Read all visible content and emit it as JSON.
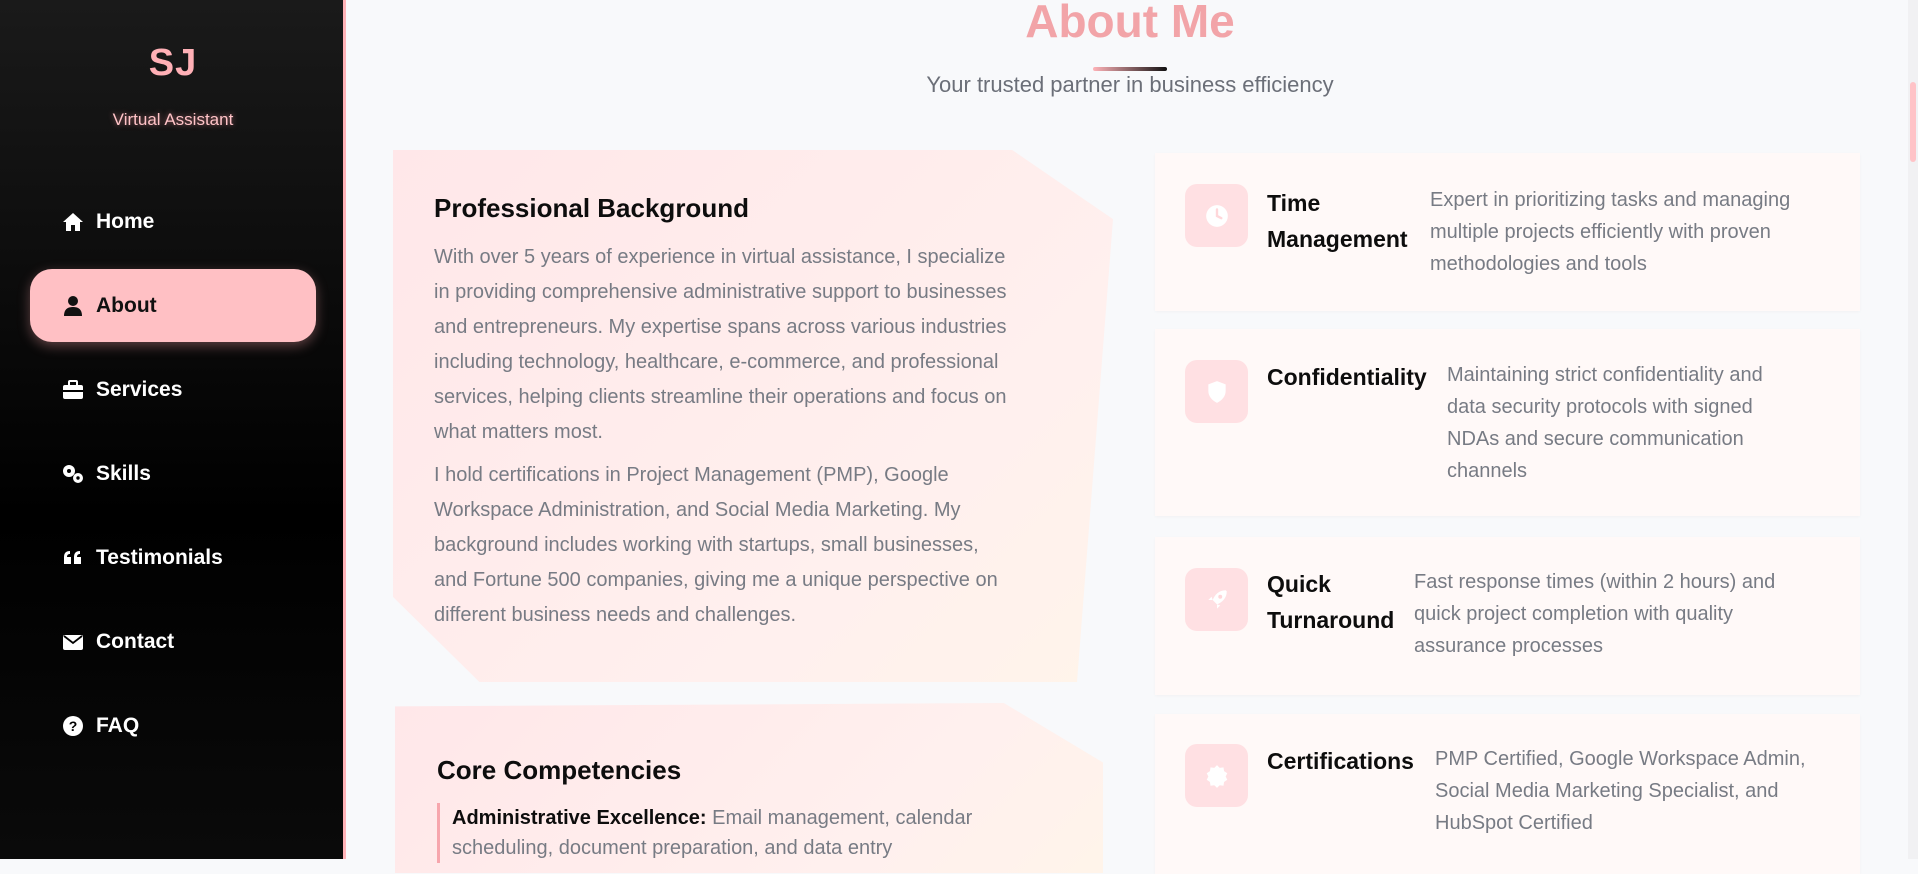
{
  "sidebar": {
    "logo": "SJ",
    "role": "Virtual Assistant",
    "items": [
      {
        "label": "Home",
        "icon": "home-icon",
        "active": false
      },
      {
        "label": "About",
        "icon": "user-icon",
        "active": true
      },
      {
        "label": "Services",
        "icon": "briefcase-icon",
        "active": false
      },
      {
        "label": "Skills",
        "icon": "gears-icon",
        "active": false
      },
      {
        "label": "Testimonials",
        "icon": "quote-icon",
        "active": false
      },
      {
        "label": "Contact",
        "icon": "envelope-icon",
        "active": false
      },
      {
        "label": "FAQ",
        "icon": "question-circle-icon",
        "active": false
      }
    ]
  },
  "header": {
    "title": "About Me",
    "subtitle": "Your trusted partner in business efficiency"
  },
  "background": {
    "heading": "Professional Background",
    "para1_lines": [
      "With over 5 years of experience in virtual assistance, I specialize",
      "in providing comprehensive administrative support to businesses",
      "and entrepreneurs. My expertise spans across various industries",
      "including technology, healthcare, e-commerce, and professional",
      "services, helping clients streamline their operations and focus on",
      "what matters most."
    ],
    "para2_lines": [
      "I hold certifications in Project Management (PMP), Google",
      "Workspace Administration, and Social Media Marketing. My",
      "background includes working with startups, small businesses,",
      "and Fortune 500 companies, giving me a unique perspective on",
      "different business needs and challenges."
    ]
  },
  "competencies": {
    "heading": "Core Competencies",
    "item_label": "Administrative Excellence:",
    "item_line1": " Email management, calendar",
    "item_line2": "scheduling, document preparation, and data entry"
  },
  "features": [
    {
      "title_lines": [
        "Time",
        "Management"
      ],
      "icon": "clock-icon",
      "desc_lines": [
        "Expert in prioritizing tasks and managing",
        "multiple projects efficiently with proven",
        "methodologies and tools"
      ]
    },
    {
      "title_lines": [
        "Confidentiality"
      ],
      "icon": "shield-icon",
      "desc_lines": [
        "Maintaining strict confidentiality and",
        "data security protocols with signed",
        "NDAs and secure communication",
        "channels"
      ]
    },
    {
      "title_lines": [
        "Quick",
        "Turnaround"
      ],
      "icon": "rocket-icon",
      "desc_lines": [
        "Fast response times (within 2 hours) and",
        "quick project completion with quality",
        "assurance processes"
      ]
    },
    {
      "title_lines": [
        "Certifications"
      ],
      "icon": "badge-icon",
      "desc_lines": [
        "PMP Certified, Google Workspace Admin,",
        "Social Media Marketing Specialist, and",
        "HubSpot Certified"
      ]
    }
  ],
  "colors": {
    "accent": "#ffc0c4",
    "title": "#f2a4a8",
    "sidebar_bg": "#000000"
  }
}
